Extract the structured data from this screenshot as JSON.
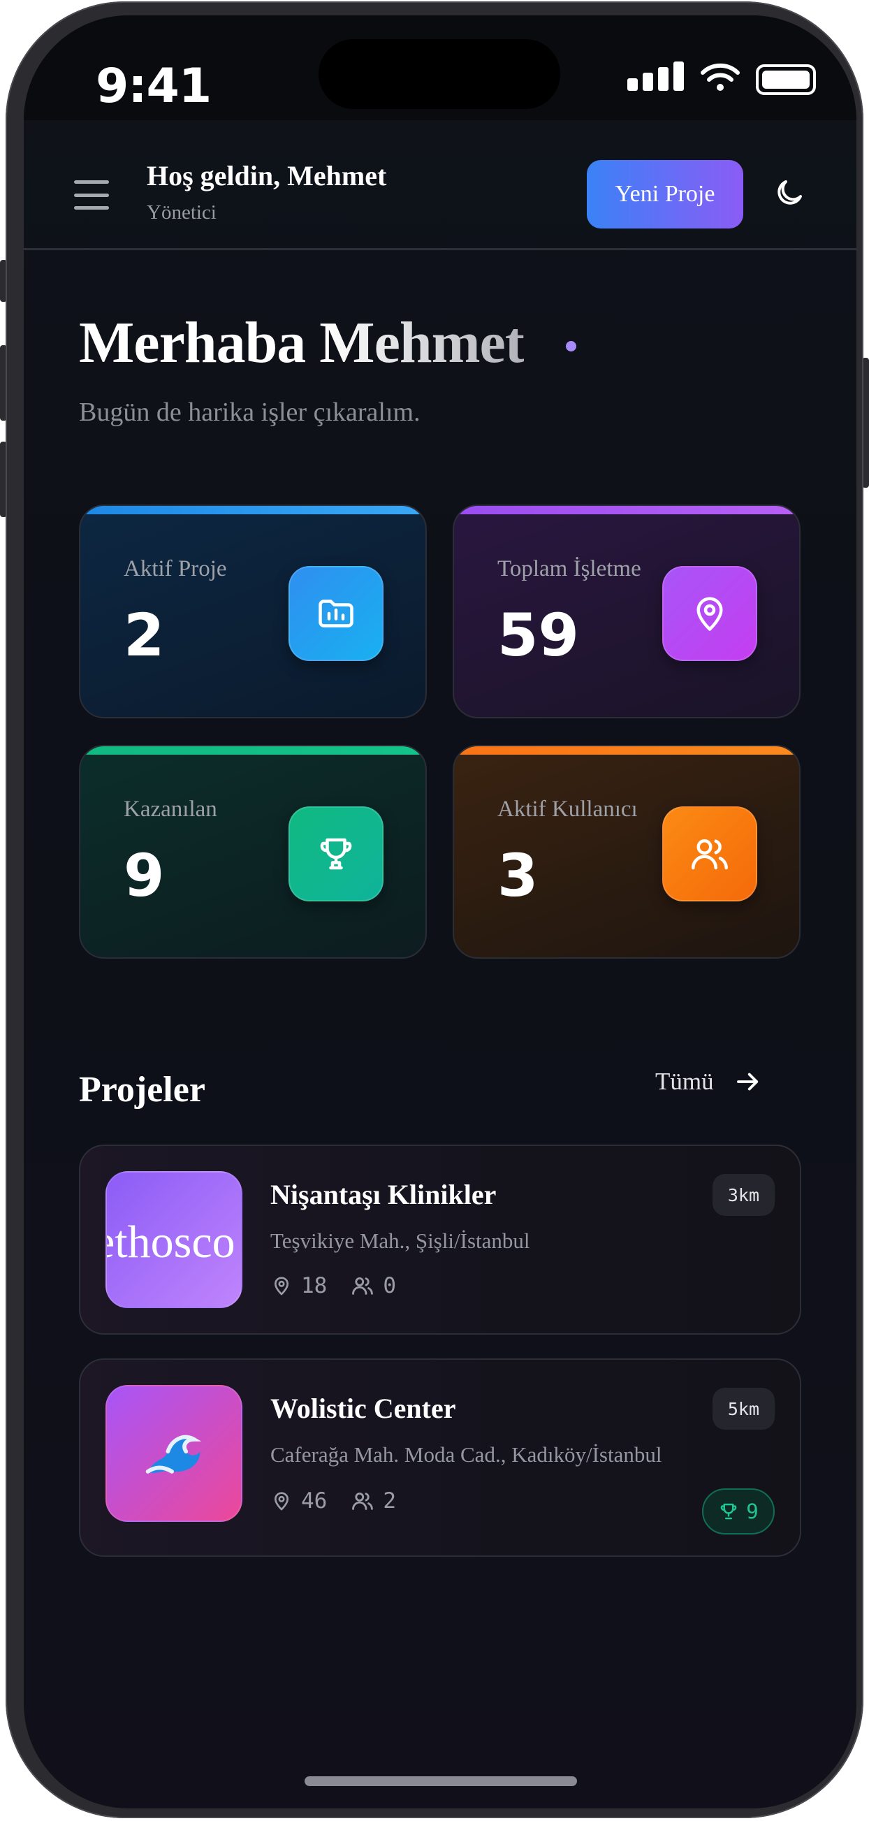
{
  "status_bar": {
    "time": "9:41"
  },
  "header": {
    "greeting": "Hoş geldin, Mehmet",
    "role": "Yönetici",
    "new_project_label": "Yeni Proje"
  },
  "hero": {
    "title": "Merhaba Mehmet",
    "subtitle": "Bugün de harika işler çıkaralım."
  },
  "stats": [
    {
      "label": "Aktif Proje",
      "value": "2",
      "icon": "folder-chart-icon",
      "accent": "#2f8ff0"
    },
    {
      "label": "Toplam İşletme",
      "value": "59",
      "icon": "map-pin-icon",
      "accent": "#a855f7"
    },
    {
      "label": "Kazanılan",
      "value": "9",
      "icon": "trophy-icon",
      "accent": "#10b981"
    },
    {
      "label": "Aktif Kullanıcı",
      "value": "3",
      "icon": "users-icon",
      "accent": "#f97316"
    }
  ],
  "projects_section": {
    "title": "Projeler",
    "all_label": "Tümü"
  },
  "projects": [
    {
      "thumb_text": "ethosco",
      "name": "Nişantaşı Klinikler",
      "address": "Teşvikiye Mah., Şişli/İstanbul",
      "distance": "3km",
      "businesses": "18",
      "users": "0"
    },
    {
      "thumb_icon": "wave-emoji-icon",
      "name": "Wolistic Center",
      "address": "Caferağa Mah. Moda Cad., Kadıköy/İstanbul",
      "distance": "5km",
      "businesses": "46",
      "users": "2",
      "won": "9"
    }
  ]
}
